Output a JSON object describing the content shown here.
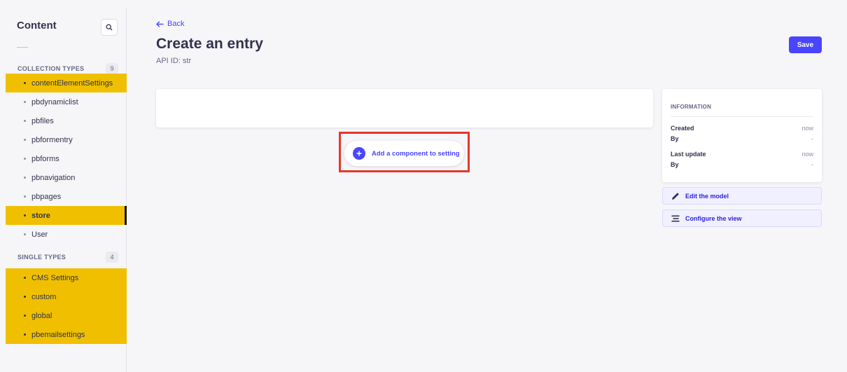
{
  "sidebar": {
    "title": "Content",
    "search_icon": "search-icon",
    "collection_types": {
      "label": "COLLECTION TYPES",
      "count": "9",
      "items": [
        {
          "label": "contentElementSettings",
          "highlighted": true
        },
        {
          "label": "pbdynamiclist",
          "highlighted": false
        },
        {
          "label": "pbfiles",
          "highlighted": false
        },
        {
          "label": "pbformentry",
          "highlighted": false
        },
        {
          "label": "pbforms",
          "highlighted": false
        },
        {
          "label": "pbnavigation",
          "highlighted": false
        },
        {
          "label": "pbpages",
          "highlighted": false
        },
        {
          "label": "store",
          "highlighted": true,
          "active": true
        },
        {
          "label": "User",
          "highlighted": false
        }
      ]
    },
    "single_types": {
      "label": "SINGLE TYPES",
      "count": "4",
      "items": [
        {
          "label": "CMS Settings",
          "highlighted": true
        },
        {
          "label": "custom",
          "highlighted": true
        },
        {
          "label": "global",
          "highlighted": true
        },
        {
          "label": "pbemailsettings",
          "highlighted": true
        }
      ]
    },
    "highlight_color": "#f0c000"
  },
  "header": {
    "back_label": "Back",
    "title": "Create an entry",
    "subtitle": "API ID: str",
    "save_label": "Save"
  },
  "editor": {
    "add_component_label": "Add a component to setting",
    "annotation_color": "#e5372b"
  },
  "information": {
    "heading": "INFORMATION",
    "created_label": "Created",
    "created_value": "now",
    "created_by_label": "By",
    "created_by_value": "-",
    "updated_label": "Last update",
    "updated_value": "now",
    "updated_by_label": "By",
    "updated_by_value": "-"
  },
  "actions": {
    "edit_model_label": "Edit the model",
    "configure_view_label": "Configure the view"
  },
  "colors": {
    "primary": "#4945ff",
    "background": "#f6f6f9"
  }
}
